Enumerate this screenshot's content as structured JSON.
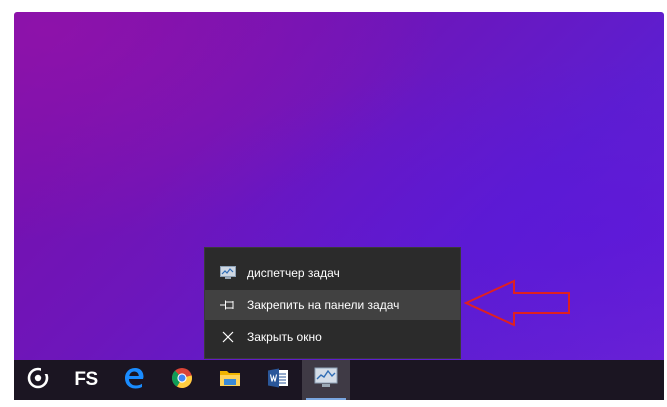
{
  "context_menu": {
    "items": [
      {
        "label": "диспетчер задач",
        "icon": "task-manager-icon"
      },
      {
        "label": "Закрепить на панели задач",
        "icon": "pin-icon"
      },
      {
        "label": "Закрыть окно",
        "icon": "close-icon"
      }
    ]
  },
  "taskbar": {
    "apps": [
      {
        "name": "groove",
        "icon": "circle-logo-icon"
      },
      {
        "name": "fs",
        "label": "FS",
        "icon": "fs-icon"
      },
      {
        "name": "edge",
        "icon": "edge-icon"
      },
      {
        "name": "chrome",
        "icon": "chrome-icon"
      },
      {
        "name": "file-explorer",
        "icon": "folder-icon"
      },
      {
        "name": "word",
        "icon": "word-icon"
      },
      {
        "name": "task-manager",
        "icon": "task-manager-icon",
        "active": true
      }
    ]
  },
  "colors": {
    "arrow": "#e02020",
    "menu_bg": "#2b2b2b",
    "menu_hover": "#414141",
    "taskbar_bg": "#1b1522"
  }
}
